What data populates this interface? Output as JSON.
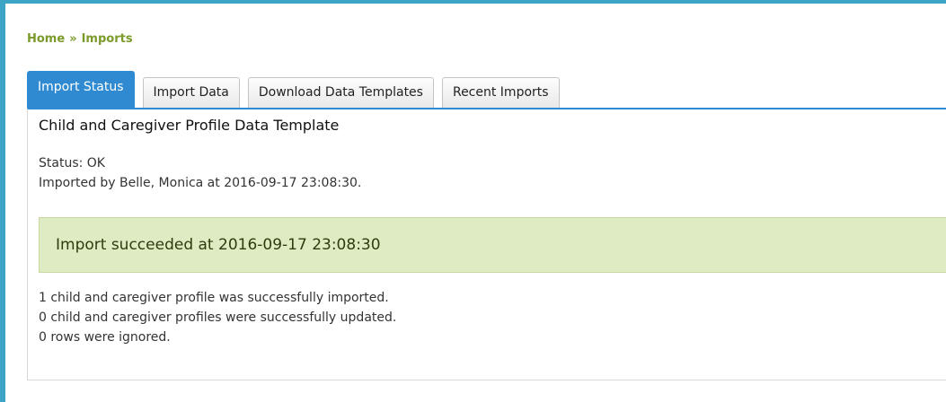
{
  "breadcrumb": {
    "home": "Home",
    "separator": "»",
    "current": "Imports"
  },
  "tabs": [
    {
      "label": "Import Status",
      "active": true
    },
    {
      "label": "Import Data",
      "active": false
    },
    {
      "label": "Download Data Templates",
      "active": false
    },
    {
      "label": "Recent Imports",
      "active": false
    }
  ],
  "panel": {
    "title": "Child and Caregiver Profile Data Template",
    "status": "Status: OK",
    "imported_by": "Imported by Belle, Monica at 2016-09-17 23:08:30.",
    "success_message": "Import succeeded at 2016-09-17 23:08:30",
    "results": [
      "1 child and caregiver profile was successfully imported.",
      "0 child and caregiver profiles were successfully updated.",
      "0 rows were ignored."
    ]
  },
  "colors": {
    "frame_border": "#3ea4c6",
    "breadcrumb": "#7a9a2a",
    "active_tab": "#2f8ad1",
    "success_background": "#dfebc2",
    "success_border": "#c6d79f"
  }
}
